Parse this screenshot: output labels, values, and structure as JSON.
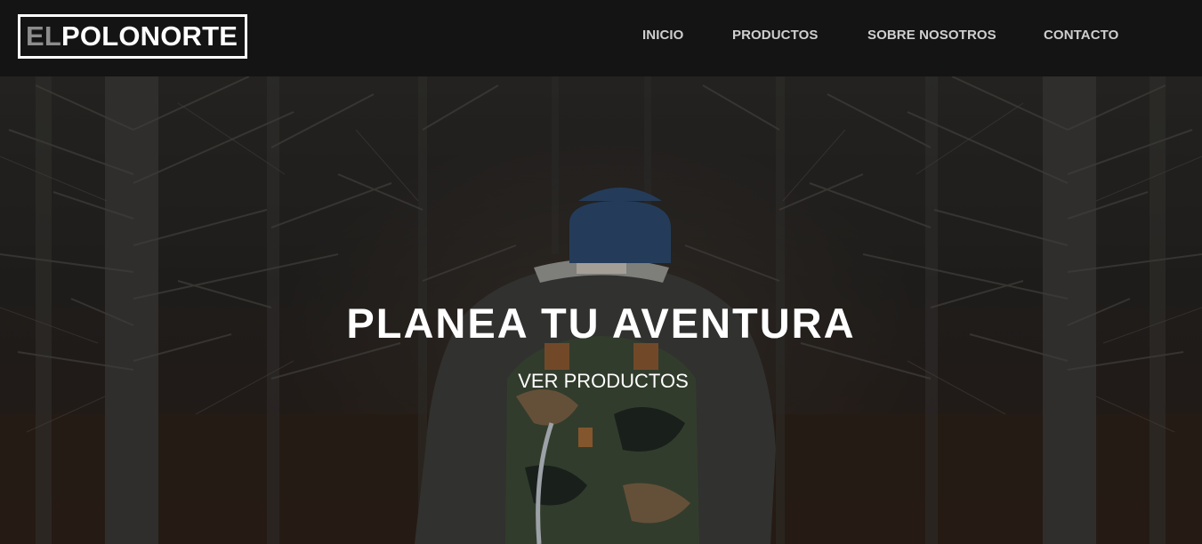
{
  "brand": {
    "logo_prefix": "EL",
    "logo_rest": "POLONORTE"
  },
  "nav": {
    "items": [
      {
        "label": "INICIO"
      },
      {
        "label": "PRODUCTOS"
      },
      {
        "label": "SOBRE NOSOTROS"
      },
      {
        "label": "CONTACTO"
      }
    ]
  },
  "hero": {
    "title": "PLANEA TU AVENTURA",
    "cta_label": "VER PRODUCTOS"
  },
  "colors": {
    "topbar_bg": "#141414",
    "logo_prefix": "#8c8c8c",
    "logo_text": "#ffffff",
    "nav_text": "#cfcfcf",
    "hero_text": "#ffffff"
  }
}
